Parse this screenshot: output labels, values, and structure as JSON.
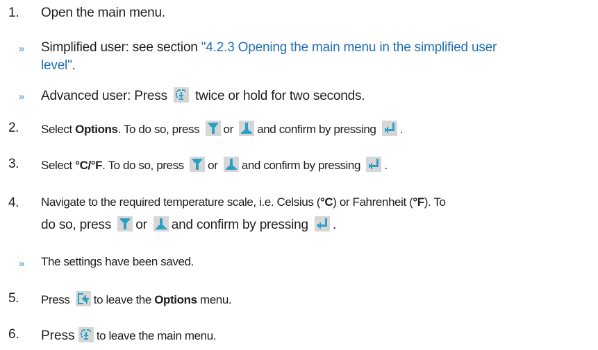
{
  "steps": [
    {
      "n": "1.",
      "text": "Open the main menu."
    },
    {
      "sub1": {
        "pre": "Simplified user: see section ",
        "link": "\"4.2.3 Opening the main menu in the simplified user",
        "link2": "level\"",
        "post": "."
      }
    },
    {
      "sub2": {
        "pre": "Advanced user: Press",
        "post": "twice or hold for two seconds."
      }
    },
    {
      "n": "2.",
      "pre": "Select ",
      "bold": "Options",
      "mid": ". To do so, press",
      "or": "or",
      "post": "and confirm by pressing",
      "end": "."
    },
    {
      "n": "3.",
      "pre": "Select ",
      "bold": "°C/°F",
      "mid": ". To do so, press",
      "or": "or",
      "post": "and confirm by pressing",
      "end": "."
    },
    {
      "n": "4.",
      "text": "Navigate to the required temperature scale, i.e. Celsius (",
      "b1": "°C",
      "t2": ") or Fahrenheit (",
      "b2": "°F",
      "t3": "). To",
      "line2pre": "do so, press",
      "or": "or",
      "post": "and confirm by pressing",
      "end": "."
    },
    {
      "sub3": {
        "text": "The settings have been saved."
      }
    },
    {
      "n": "5.",
      "pre": "Press",
      "post": "to leave the ",
      "bold": "Options",
      "end": " menu."
    },
    {
      "n": "6.",
      "pre": "Press",
      "post": "to leave the main menu."
    }
  ],
  "bullet_glyph": "»",
  "icons": {
    "menu": "main-menu-icon",
    "down": "down-arrow-icon",
    "up": "up-arrow-icon",
    "enter": "enter-icon",
    "back": "back-icon"
  }
}
